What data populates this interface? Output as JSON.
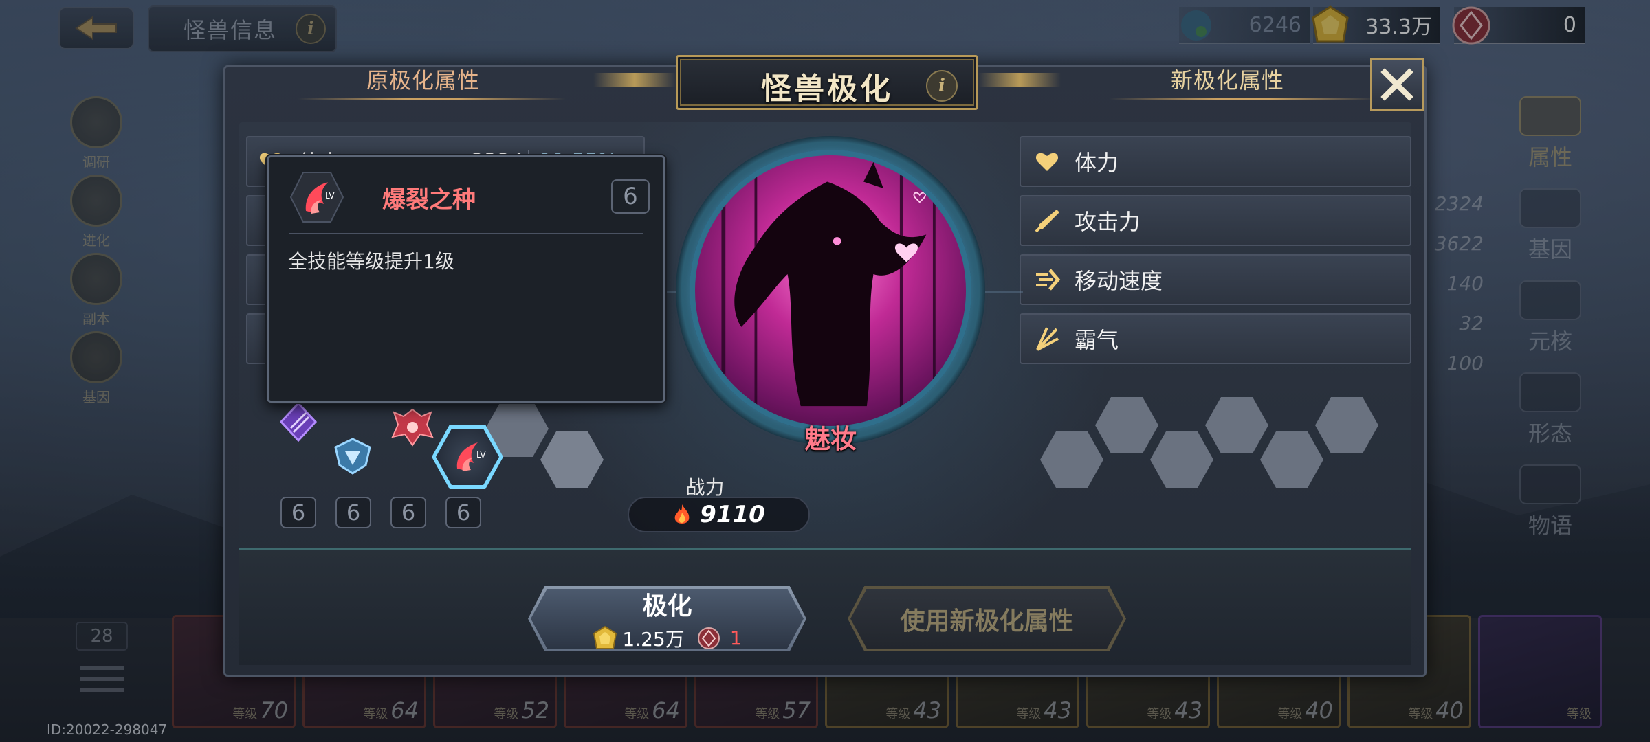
{
  "header": {
    "back_icon": "arrow-left-icon",
    "page_tab": "怪兽信息",
    "info_label": "i"
  },
  "currencies": {
    "energy": "6246",
    "gold": "33.3万",
    "crystal": "0"
  },
  "side_menu_left": [
    "调研",
    "进化",
    "副本",
    "基因"
  ],
  "side_menu_right": [
    "属性",
    "基因",
    "元核",
    "形态",
    "物语"
  ],
  "stat_column": [
    "2324",
    "3622",
    "140",
    "32",
    "100"
  ],
  "dialog": {
    "title": "怪兽极化",
    "info_label": "i",
    "left_section_title": "原极化属性",
    "right_section_title": "新极化属性",
    "left_attrs": [
      {
        "label": "体力",
        "value": "2324",
        "pct": "99.55%"
      }
    ],
    "new_attrs": [
      {
        "label": "体力",
        "icon": "heart-icon"
      },
      {
        "label": "攻击力",
        "icon": "sword-icon"
      },
      {
        "label": "移动速度",
        "icon": "speed-icon"
      },
      {
        "label": "霸气",
        "icon": "claw-icon"
      }
    ],
    "monster_name": "魅妆",
    "power_label": "战力",
    "power_value": "9110",
    "skill_levels": [
      "6",
      "6",
      "6",
      "6"
    ],
    "tooltip": {
      "skill_name": "爆裂之种",
      "skill_level": "6",
      "description": "全技能等级提升1级"
    },
    "buttons": {
      "polarize_label": "极化",
      "polarize_cost_gold": "1.25万",
      "polarize_cost_item": "1",
      "use_new_label": "使用新极化属性"
    }
  },
  "hero_strip": [
    {
      "level_label": "等级",
      "level": "70",
      "style": "red"
    },
    {
      "level_label": "等级",
      "level": "64",
      "style": "red"
    },
    {
      "level_label": "等级",
      "level": "52",
      "style": "red"
    },
    {
      "level_label": "等级",
      "level": "64",
      "style": "red"
    },
    {
      "level_label": "等级",
      "level": "57",
      "style": "red"
    },
    {
      "level_label": "等级",
      "level": "43",
      "style": "gold"
    },
    {
      "level_label": "等级",
      "level": "43",
      "style": "gold"
    },
    {
      "level_label": "等级",
      "level": "43",
      "style": "gold"
    },
    {
      "level_label": "等级",
      "level": "40",
      "style": "gold"
    },
    {
      "level_label": "等级",
      "level": "40",
      "style": "gold"
    },
    {
      "level_label": "等级",
      "level": "",
      "style": "purple"
    }
  ],
  "strip_count": "28",
  "uid": "ID:20022-298047",
  "colors": {
    "accent_gold": "#c9a062",
    "skill_red": "#ff7a7a",
    "monster_name": "#ff7a8a",
    "selected_hex": "#7ad8ff"
  }
}
